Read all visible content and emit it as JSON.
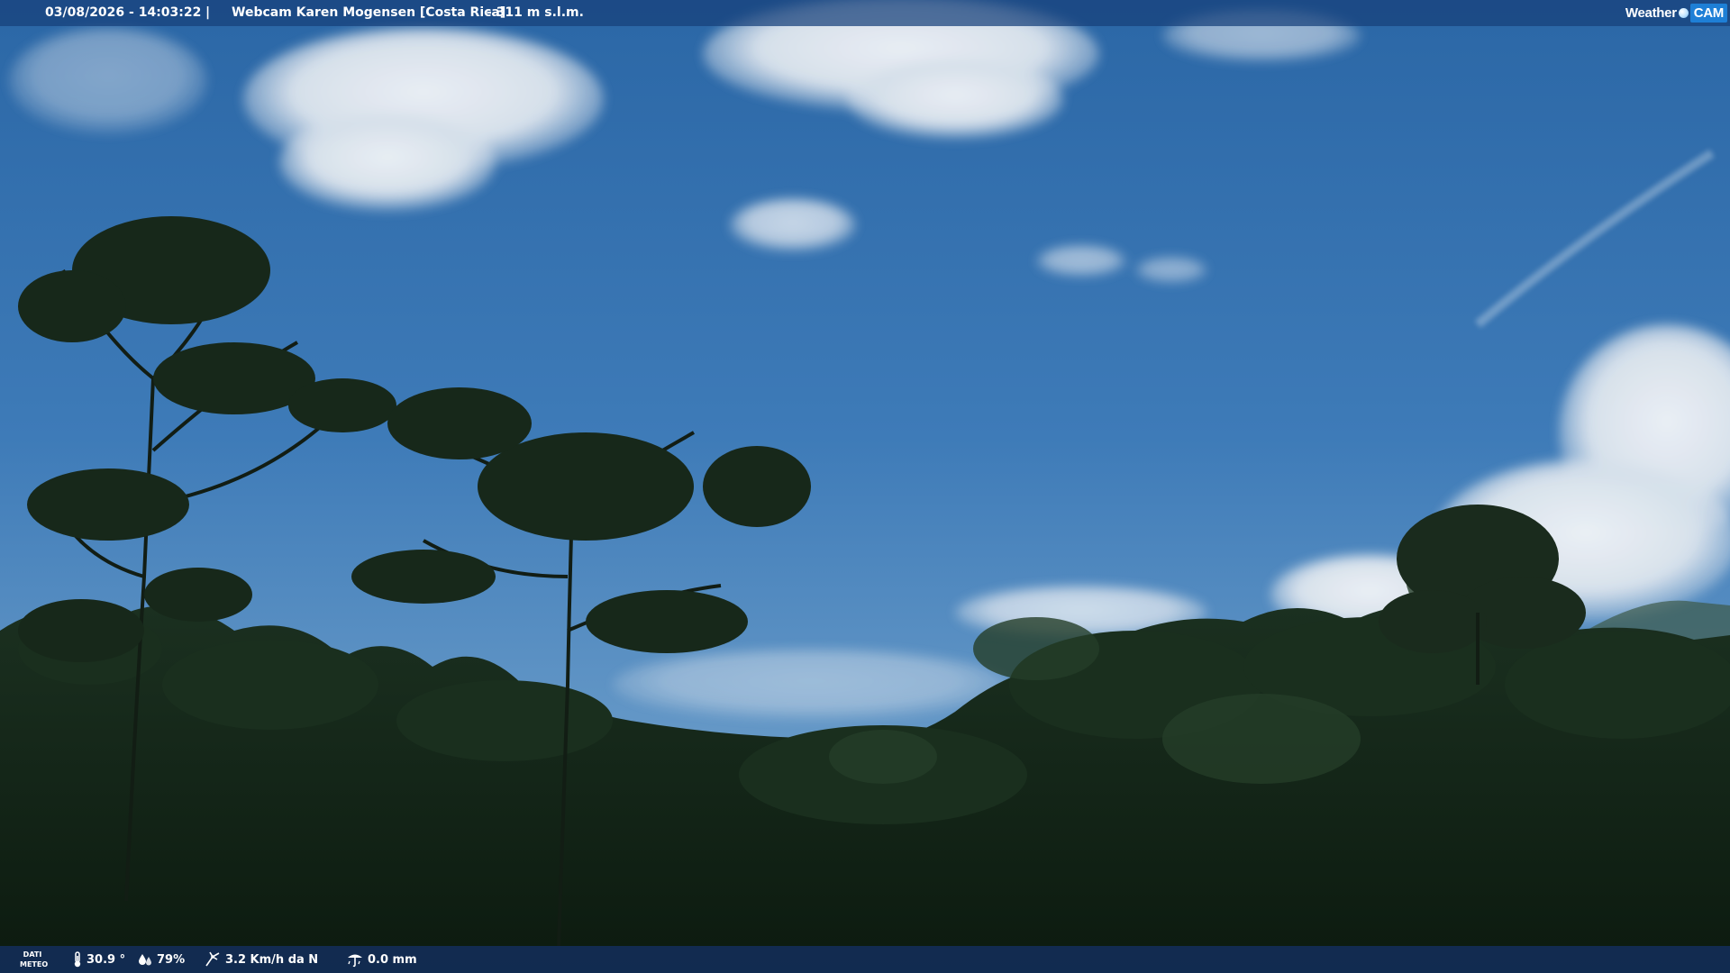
{
  "header": {
    "datetime": "03/08/2026 - 14:03:22",
    "separator": "|",
    "webcam_title": "Webcam Karen Mogensen [Costa Rica]",
    "altitude": "- 311 m s.l.m.",
    "brand_left": "Weather",
    "brand_right": "CAM"
  },
  "weather": {
    "section_label": "DATI METEO",
    "temperature": "30.9 °",
    "humidity": "79%",
    "wind": "3.2 Km/h da N",
    "rain": "0.0 mm"
  },
  "colors": {
    "sky_top": "#2c6aa9",
    "sky_bottom": "#6b9cc6",
    "vegetation": "#0f1e12",
    "bar_bg": "#14407a"
  },
  "icons": {
    "temperature": "thermometer-icon",
    "humidity": "droplets-icon",
    "wind": "wind-vane-icon",
    "rain": "rain-gauge-icon"
  }
}
